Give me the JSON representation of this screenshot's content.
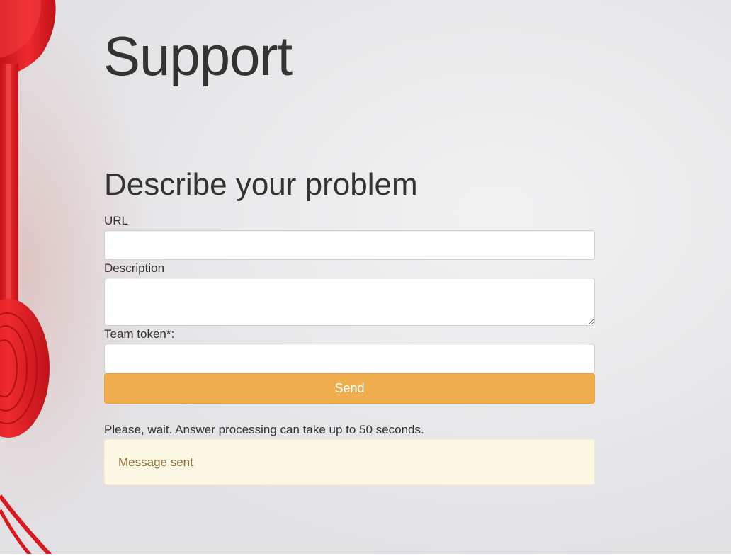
{
  "page": {
    "title": "Support",
    "section_title": "Describe your problem"
  },
  "form": {
    "url_label": "URL",
    "url_value": "",
    "description_label": "Description",
    "description_value": "",
    "token_label": "Team token*:",
    "token_value": "",
    "send_label": "Send"
  },
  "status": {
    "wait_text": "Please, wait. Answer processing can take up to 50 seconds.",
    "alert_text": "Message sent"
  },
  "colors": {
    "button": "#f0ad4e",
    "alert_bg": "#fcf8e3",
    "alert_text": "#8a6d3b",
    "phone": "#e8222a"
  },
  "decor": {
    "background_image": "red-telephone-handset"
  }
}
